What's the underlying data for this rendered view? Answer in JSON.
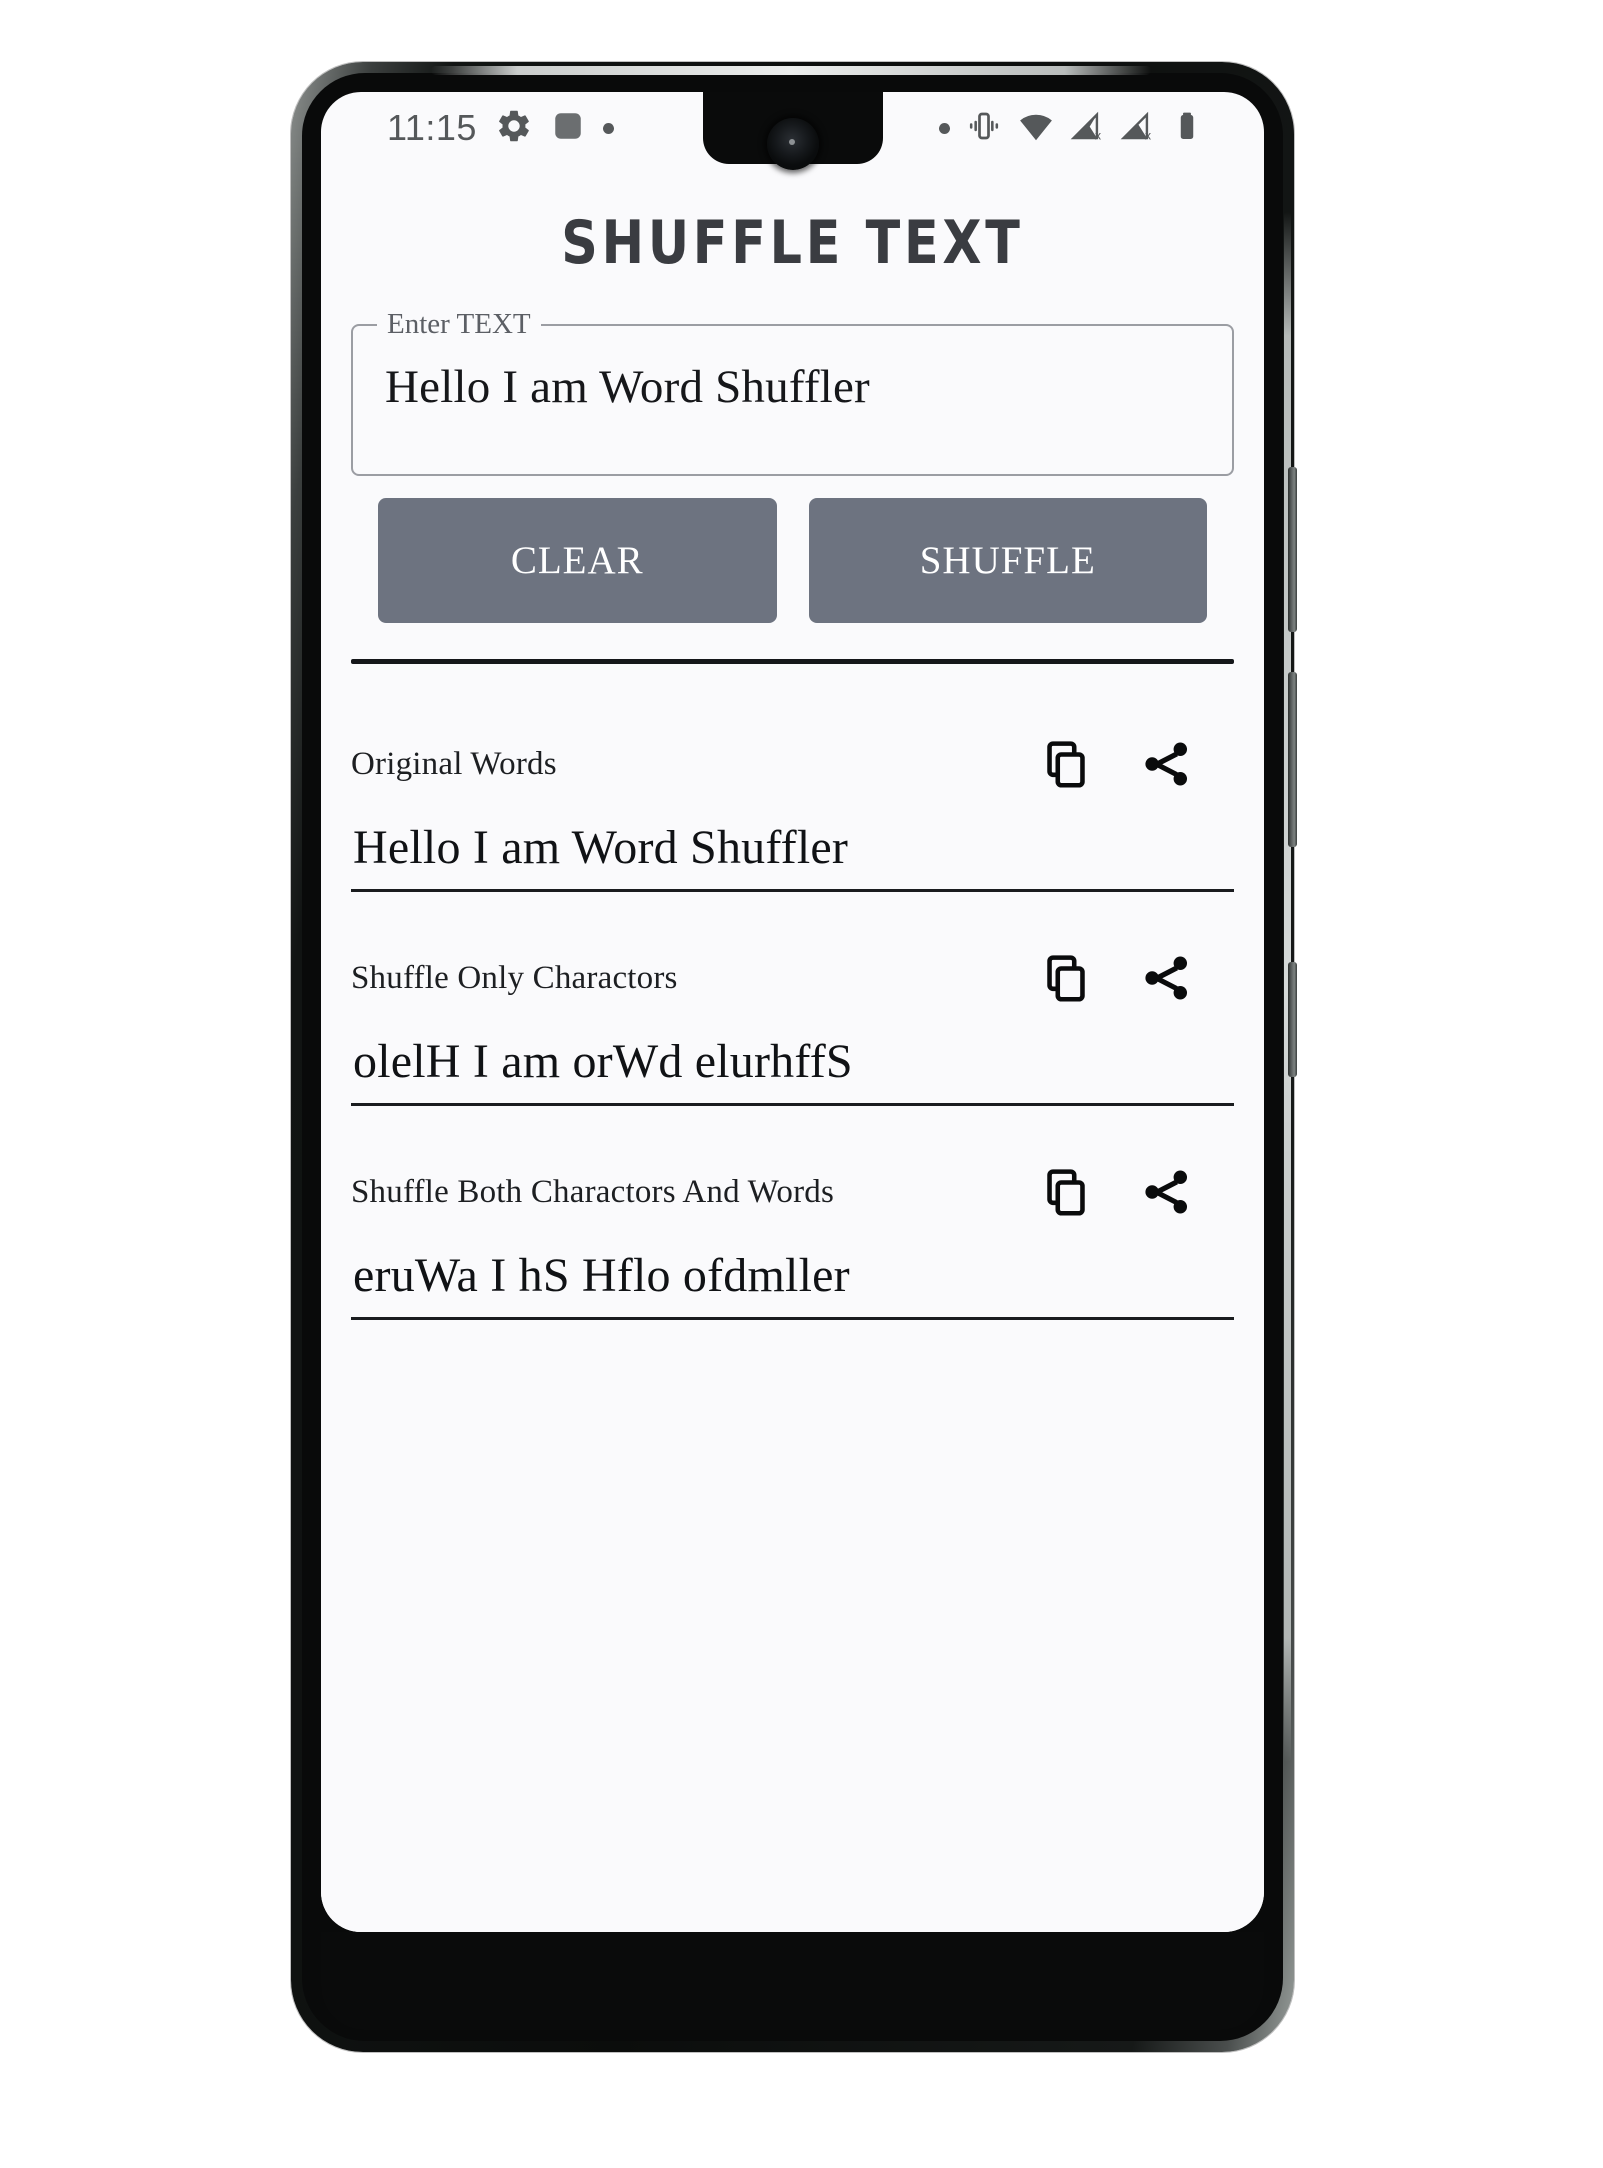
{
  "status_bar": {
    "clock": "11:15",
    "left_icons": [
      "gear-icon",
      "stop-square-icon",
      "dot-icon"
    ],
    "right_icons": [
      "dot-icon",
      "vibrate-icon",
      "wifi-icon",
      "signal-no-sim-1-icon",
      "signal-no-sim-2-icon",
      "battery-icon"
    ]
  },
  "app": {
    "title": "SHUFFLE TEXT",
    "accent_color": "#6d7380",
    "background_color": "#fafafc",
    "text_color": "#101215"
  },
  "input": {
    "label": "Enter TEXT",
    "value": "Hello I am Word Shuffler",
    "placeholder": "Enter TEXT"
  },
  "buttons": {
    "clear": "CLEAR",
    "shuffle": "SHUFFLE"
  },
  "results": [
    {
      "label": "Original Words",
      "value": "Hello I am Word Shuffler",
      "copy_icon": "copy-icon",
      "share_icon": "share-icon"
    },
    {
      "label": "Shuffle Only Charactors",
      "value": "olelH I am orWd elurhffS",
      "copy_icon": "copy-icon",
      "share_icon": "share-icon"
    },
    {
      "label": "Shuffle Both Charactors And Words",
      "value": "eruWa I hS Hflo ofdmller",
      "copy_icon": "copy-icon",
      "share_icon": "share-icon"
    }
  ]
}
